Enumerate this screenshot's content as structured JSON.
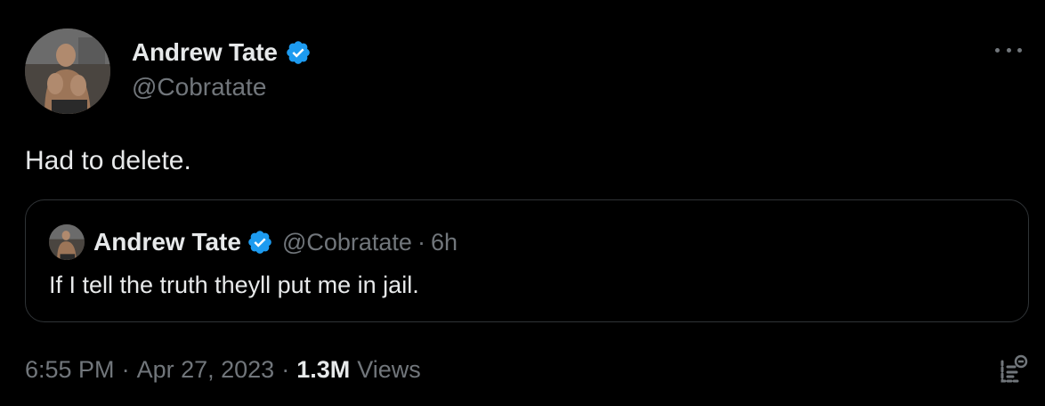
{
  "tweet": {
    "author": {
      "display_name": "Andrew Tate",
      "handle": "@Cobratate",
      "verified_icon": "verified-badge-icon"
    },
    "text": "Had to delete.",
    "quoted": {
      "display_name": "Andrew Tate",
      "handle": "@Cobratate",
      "separator": "·",
      "time": "6h",
      "text": "If I tell the truth theyll put me in jail."
    },
    "meta": {
      "time": "6:55 PM",
      "separator_1": "·",
      "date": "Apr 27, 2023",
      "separator_2": "·",
      "views_count": "1.3M",
      "views_label": "Views"
    }
  },
  "icons": {
    "more": "more-icon",
    "analytics": "analytics-icon"
  },
  "colors": {
    "background": "#000000",
    "text_primary": "#e7e9ea",
    "text_secondary": "#71767b",
    "verified_blue": "#1d9bf0",
    "border": "#2f3336"
  }
}
